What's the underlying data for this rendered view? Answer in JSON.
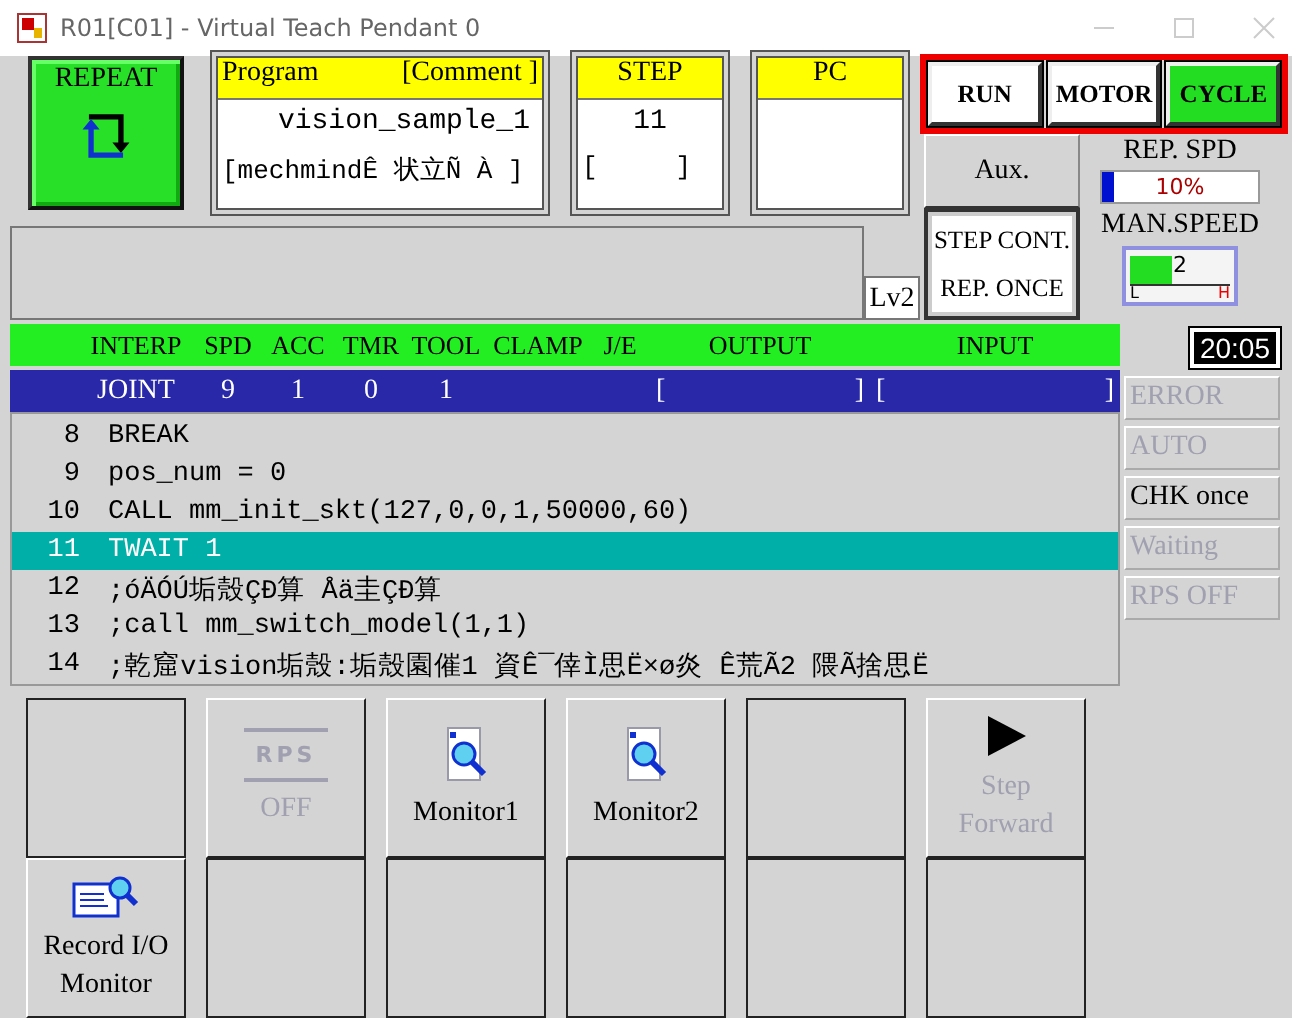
{
  "window": {
    "title": "R01[C01] - Virtual Teach Pendant 0"
  },
  "mode": {
    "label": "REPEAT"
  },
  "program": {
    "heading_left": "Program",
    "heading_right": "[Comment ]",
    "name": "vision_sample_1",
    "comment": "[mechmindÊ 状立Ñ À ]"
  },
  "step": {
    "heading": "STEP",
    "value": "11",
    "comment": "[     ]"
  },
  "pc": {
    "heading": "PC"
  },
  "status_buttons": [
    {
      "label": "RUN",
      "on": false
    },
    {
      "label": "MOTOR",
      "on": false
    },
    {
      "label": "CYCLE",
      "on": true
    }
  ],
  "aux": {
    "label": "Aux."
  },
  "rep_speed": {
    "label": "REP. SPD",
    "level": 0.08,
    "reading": "10%"
  },
  "step_mode": {
    "lines": [
      "STEP CONT.",
      "REP. ONCE"
    ]
  },
  "level_badge": "Lv2",
  "man_speed": {
    "label": "MAN.SPEED",
    "level": 0.42,
    "reading": "2",
    "low_mark": "L",
    "high_mark": "H"
  },
  "status_header": [
    "INTERP",
    "SPD",
    "ACC",
    "TMR",
    "TOOL",
    "CLAMP",
    "J/E",
    "OUTPUT",
    "INPUT"
  ],
  "status_values": {
    "interp": "JOINT",
    "spd": "9",
    "acc": "1",
    "tmr": "0",
    "tool": "1",
    "output": [
      "[",
      "]"
    ],
    "input": [
      "[",
      "]"
    ]
  },
  "clock": "20:05",
  "program_lines": [
    {
      "number": "8",
      "text": "BREAK",
      "selected": false
    },
    {
      "number": "9",
      "text": "pos_num = 0",
      "selected": false
    },
    {
      "number": "10",
      "text": "CALL mm_init_skt(127,0,0,1,50000,60)",
      "selected": false
    },
    {
      "number": "11",
      "text": "TWAIT 1",
      "selected": true
    },
    {
      "number": "12",
      "text": ";óÄÓÚ垢殼ÇÐ算  Åä圭ÇÐ算",
      "selected": false
    },
    {
      "number": "13",
      "text": ";call mm_switch_model(1,1)",
      "selected": false
    },
    {
      "number": "14",
      "text": ";乾窟vision垢殼:垢殼園催1  資Ê¯倖Ì思Ë×ø炎  Ê荒Ã2  隈Ã捨思Ë",
      "selected": false
    }
  ],
  "indicators": [
    {
      "label": "ERROR",
      "disabled": true
    },
    {
      "label": "AUTO",
      "disabled": true
    },
    {
      "label": "CHK once",
      "disabled": false
    },
    {
      "label": "Waiting",
      "disabled": true
    },
    {
      "label": "RPS OFF",
      "disabled": true
    }
  ],
  "keys": [
    {
      "kind": "blank"
    },
    {
      "kind": "rps",
      "icon_text": "RPS",
      "lines": [
        "OFF"
      ],
      "disabled": true
    },
    {
      "kind": "monitor",
      "lines": [
        "Monitor1"
      ],
      "disabled": false
    },
    {
      "kind": "monitor",
      "lines": [
        "Monitor2"
      ],
      "disabled": false
    },
    {
      "kind": "blank"
    },
    {
      "kind": "play",
      "lines": [
        "Step",
        "Forward"
      ],
      "disabled": true
    },
    {
      "kind": "record",
      "lines": [
        "Record I/O",
        "Monitor"
      ],
      "disabled": false
    },
    {
      "kind": "blank"
    },
    {
      "kind": "blank"
    },
    {
      "kind": "blank"
    },
    {
      "kind": "blank"
    },
    {
      "kind": "blank"
    }
  ]
}
